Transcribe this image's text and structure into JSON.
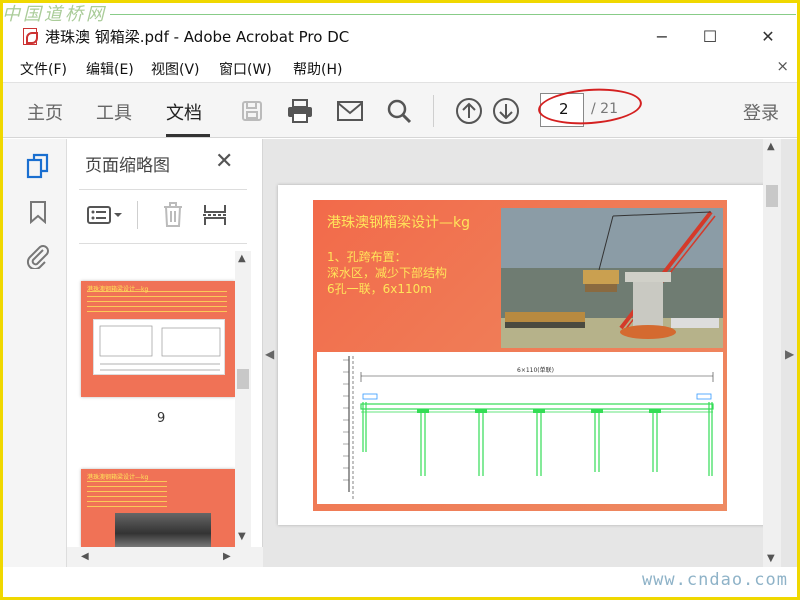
{
  "watermarks": {
    "top": "中国道桥网",
    "bottom": "www.cndao.com"
  },
  "titlebar": {
    "title": "港珠澳 钢箱梁.pdf - Adobe Acrobat Pro DC",
    "minimize": "−",
    "maximize": "☐",
    "close": "✕"
  },
  "menu": {
    "items": [
      "文件(F)",
      "编辑(E)",
      "视图(V)",
      "窗口(W)",
      "帮助(H)"
    ],
    "close": "×"
  },
  "toolbar": {
    "tabs": [
      "主页",
      "工具",
      "文档"
    ],
    "active_tab": "文档",
    "page_current": "2",
    "page_total": "/ 21",
    "login": "登录",
    "icons": [
      "save-icon",
      "print-icon",
      "email-icon",
      "search-icon",
      "page-up-icon",
      "page-down-icon"
    ]
  },
  "sidebar": {
    "icons": [
      "page-thumbnails-icon",
      "bookmark-icon",
      "attachment-icon"
    ]
  },
  "thumbnails_panel": {
    "title": "页面缩略图",
    "close": "✕",
    "page_labels": [
      "9"
    ],
    "thumb_a_title": "港珠澳钢箱梁设计—kg",
    "thumb_b_title": "港珠澳钢箱梁设计—kg"
  },
  "slide": {
    "title": "港珠澳钢箱梁设计—kg",
    "lines": [
      "1、孔跨布置：",
      "深水区，减少下部结构",
      "6孔一联，6x110m"
    ],
    "drawing_label": "6×110(单联)"
  },
  "colors": {
    "accent_blue": "#1a6fd0",
    "highlight_red": "#d42020",
    "slide_text": "#ffe45a",
    "frame_yellow": "#f0d800"
  }
}
